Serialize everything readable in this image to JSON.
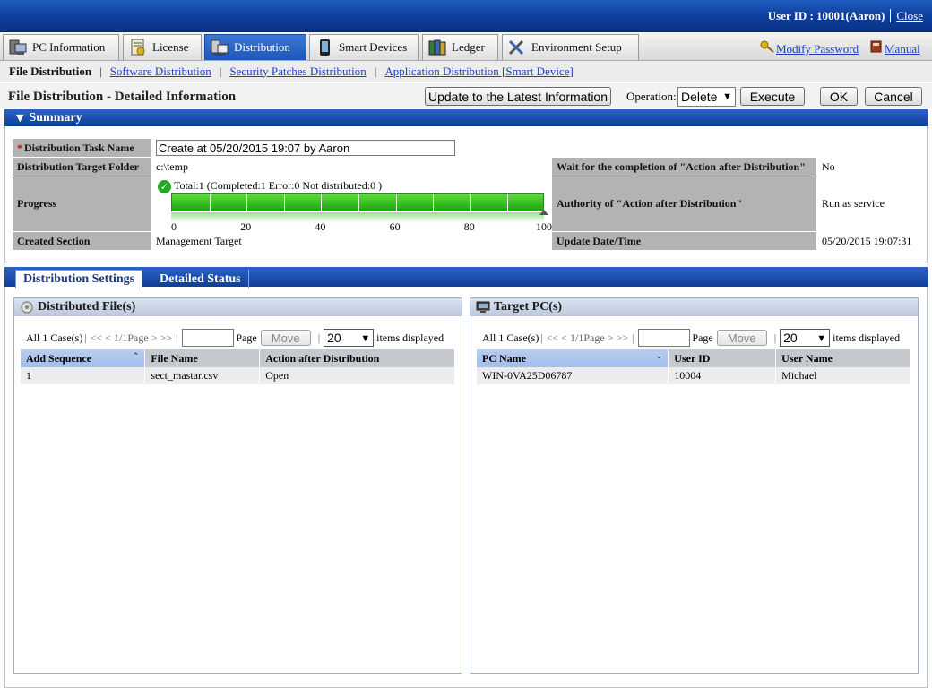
{
  "header": {
    "user_id": "User ID : 10001(Aaron)",
    "close_label": "Close"
  },
  "nav": {
    "tabs": [
      {
        "label": "PC Information",
        "icon": "pc-icon"
      },
      {
        "label": "License",
        "icon": "license-icon"
      },
      {
        "label": "Distribution",
        "icon": "distribution-icon"
      },
      {
        "label": "Smart Devices",
        "icon": "smart-device-icon"
      },
      {
        "label": "Ledger",
        "icon": "ledger-icon"
      },
      {
        "label": "Environment Setup",
        "icon": "tools-icon"
      }
    ],
    "active_tab": "Distribution",
    "modify_password": "Modify Password",
    "manual": "Manual"
  },
  "subnav": {
    "current": "File Distribution",
    "links": [
      "Software Distribution",
      "Security Patches Distribution",
      "Application Distribution [Smart Device]"
    ]
  },
  "page": {
    "title": "File Distribution - Detailed Information",
    "update_button": "Update to the Latest Information",
    "operation_label": "Operation:",
    "operation_value": "Delete",
    "execute_button": "Execute",
    "ok_button": "OK",
    "cancel_button": "Cancel"
  },
  "summary": {
    "title": "Summary",
    "task_name_label": "Distribution Task Name",
    "task_name_value": "Create at 05/20/2015 19:07 by Aaron",
    "folder_label": "Distribution Target Folder",
    "folder_value": "c:\\temp",
    "wait_label": "Wait for the completion of \"Action after Distribution\"",
    "wait_value": "No",
    "progress_label": "Progress",
    "progress_text": "Total:1  (Completed:1  Error:0  Not distributed:0 )",
    "progress_percent": 100,
    "progress_ticks": [
      "0",
      "20",
      "40",
      "60",
      "80",
      "100"
    ],
    "authority_label": "Authority of \"Action after Distribution\"",
    "authority_value": "Run as service",
    "created_label": "Created Section",
    "created_value": "Management Target",
    "update_label": "Update Date/Time",
    "update_value": "05/20/2015 19:07:31"
  },
  "tabs": {
    "settings": "Distribution Settings",
    "status": "Detailed Status"
  },
  "files_pane": {
    "title": "Distributed File(s)",
    "all_cases": "All 1 Case(s)",
    "page_nav": "<< < 1/1Page > >>",
    "page_label": "Page",
    "move_button": "Move",
    "count_value": "20",
    "items_label": "items displayed",
    "columns": [
      "Add Sequence",
      "File Name",
      "Action after Distribution"
    ],
    "rows": [
      [
        "1",
        "sect_mastar.csv",
        "Open"
      ]
    ]
  },
  "pc_pane": {
    "title": "Target PC(s)",
    "all_cases": "All 1 Case(s)",
    "page_nav": "<< < 1/1Page > >>",
    "page_label": "Page",
    "move_button": "Move",
    "count_value": "20",
    "items_label": "items displayed",
    "columns": [
      "PC Name",
      "User ID",
      "User Name"
    ],
    "rows": [
      [
        "WIN-0VA25D06787",
        "10004",
        "Michael"
      ]
    ]
  }
}
